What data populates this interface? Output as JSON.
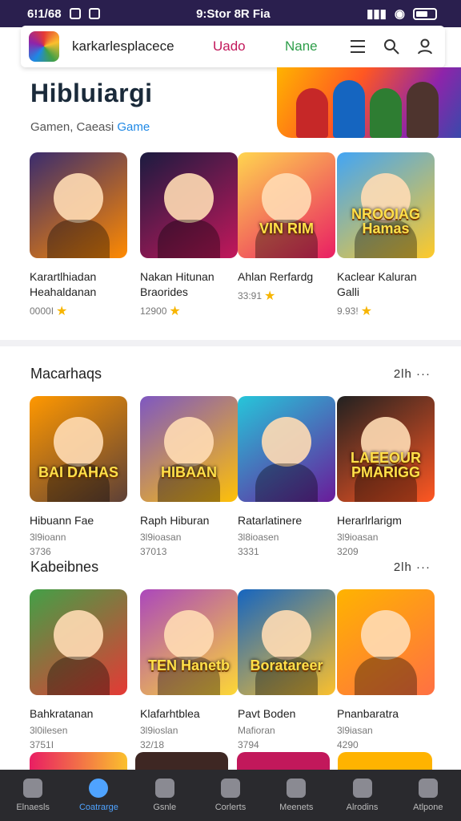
{
  "status": {
    "time": "6!1/68",
    "center": "9:Stor 8R Fia"
  },
  "header": {
    "brand": "karkarlesplacece",
    "nav1": "Uado",
    "nav2": "Nane"
  },
  "hero": {
    "title": "Hibluiargi",
    "subtitle": "Gamen, Caeasi",
    "subtitle_link": "Game"
  },
  "featured": [
    {
      "title": "Karartlhiadan Heahaldanan",
      "meta": "0000I",
      "colors": [
        "#3a2c6e",
        "#ff8a00"
      ],
      "badge": ""
    },
    {
      "title": "Nakan Hitunan Braorides",
      "meta": "12900",
      "colors": [
        "#1b1b40",
        "#c2185b"
      ],
      "badge": ""
    },
    {
      "title": "Ahlan Rerfardg",
      "meta": "33:91",
      "colors": [
        "#ffd54f",
        "#e91e63"
      ],
      "badge": "VIN RIM"
    },
    {
      "title": "Kaclear Kaluran Galli",
      "meta": "9.93!",
      "colors": [
        "#42a5f5",
        "#ffca28"
      ],
      "badge": "NROOIAG Hamas"
    }
  ],
  "section1": {
    "title": "Macarhaqs",
    "more": "2lh ···",
    "items": [
      {
        "title": "Hibuann Fae",
        "line1": "3l9ioann",
        "line2": "3736",
        "colors": [
          "#ff9800",
          "#5d4037"
        ],
        "badge": "BAI DAHAS"
      },
      {
        "title": "Raph Hiburan",
        "line1": "3l9ioasan",
        "line2": "37013",
        "colors": [
          "#7e57c2",
          "#ffc107"
        ],
        "badge": "HIBAAN"
      },
      {
        "title": "Ratarlatinere",
        "line1": "3l8ioasen",
        "line2": "3331",
        "colors": [
          "#26c6da",
          "#6a1b9a"
        ],
        "badge": ""
      },
      {
        "title": "Herarlrlarigm",
        "line1": "3l9ioasan",
        "line2": "3209",
        "colors": [
          "#212121",
          "#ff5722"
        ],
        "badge": "LAEEOUR PMARIGG"
      }
    ]
  },
  "section2": {
    "title": "Kabeibnes",
    "more": "2lh ···",
    "items": [
      {
        "title": "Bahkratanan",
        "line1": "3l0ilesen",
        "line2": "3751I",
        "colors": [
          "#43a047",
          "#e53935"
        ],
        "badge": ""
      },
      {
        "title": "Klafarhtblea",
        "line1": "3l9ioslan",
        "line2": "32/18",
        "colors": [
          "#ab47bc",
          "#fdd835"
        ],
        "badge": "TEN Hanetb"
      },
      {
        "title": "Pavt Boden",
        "line1": "Mafioran",
        "line2": "3794",
        "colors": [
          "#1565c0",
          "#fbc02d"
        ],
        "badge": "Boratareer"
      },
      {
        "title": "Pnanbaratra",
        "line1": "3l9iasan",
        "line2": "4290",
        "colors": [
          "#ffb300",
          "#ff7043"
        ],
        "badge": ""
      }
    ]
  },
  "tabs": [
    {
      "label": "Elnaesls",
      "active": false
    },
    {
      "label": "Coatrarge",
      "active": true
    },
    {
      "label": "Gsnle",
      "active": false
    },
    {
      "label": "Corlerts",
      "active": false
    },
    {
      "label": "Meenets",
      "active": false
    },
    {
      "label": "Alrodins",
      "active": false
    },
    {
      "label": "Atlpone",
      "active": false
    }
  ]
}
